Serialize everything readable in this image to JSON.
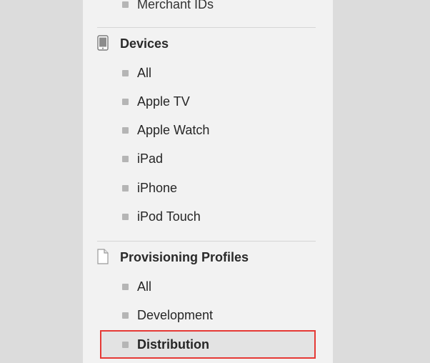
{
  "sections": {
    "cut_item": "Merchant IDs",
    "devices": {
      "title": "Devices",
      "icon": "device-icon",
      "items": [
        "All",
        "Apple TV",
        "Apple Watch",
        "iPad",
        "iPhone",
        "iPod Touch"
      ]
    },
    "profiles": {
      "title": "Provisioning Profiles",
      "icon": "document-icon",
      "items": [
        "All",
        "Development",
        "Distribution"
      ],
      "selected": "Distribution"
    }
  },
  "colors": {
    "page_bg": "#dcdcdc",
    "sidebar_bg": "#f2f2f2",
    "highlight_border": "#e53935"
  }
}
